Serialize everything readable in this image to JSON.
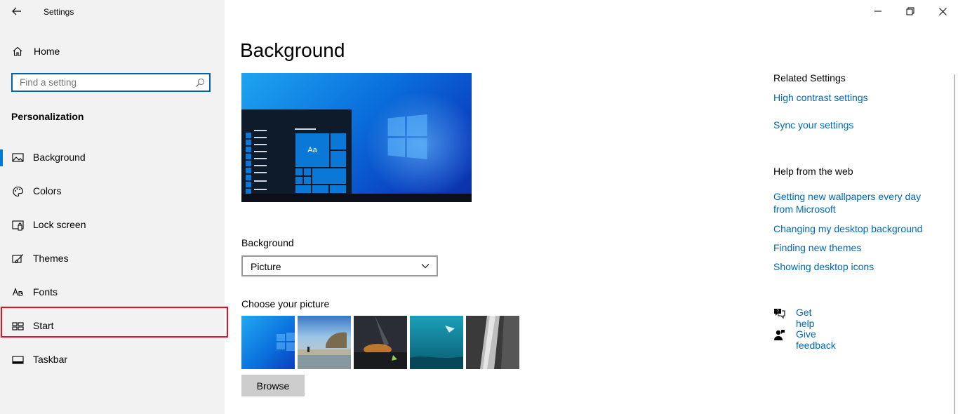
{
  "app": {
    "title": "Settings"
  },
  "sidebar": {
    "home_label": "Home",
    "search_placeholder": "Find a setting",
    "section_title": "Personalization",
    "items": [
      {
        "label": "Background",
        "icon": "image-icon",
        "selected": true
      },
      {
        "label": "Colors",
        "icon": "palette-icon"
      },
      {
        "label": "Lock screen",
        "icon": "lock-screen-icon"
      },
      {
        "label": "Themes",
        "icon": "brush-icon"
      },
      {
        "label": "Fonts",
        "icon": "font-icon"
      },
      {
        "label": "Start",
        "icon": "start-icon",
        "highlighted": true
      },
      {
        "label": "Taskbar",
        "icon": "taskbar-icon"
      }
    ]
  },
  "main": {
    "title": "Background",
    "preview": {
      "tile_text": "Aa"
    },
    "background_label": "Background",
    "background_value": "Picture",
    "choose_label": "Choose your picture",
    "browse_label": "Browse"
  },
  "related": {
    "heading": "Related Settings",
    "links": [
      "High contrast settings",
      "Sync your settings"
    ]
  },
  "help_web": {
    "heading": "Help from the web",
    "links": [
      "Getting new wallpapers every day from Microsoft",
      "Changing my desktop background",
      "Finding new themes",
      "Showing desktop icons"
    ]
  },
  "support": {
    "get_help": "Get help",
    "give_feedback": "Give feedback"
  },
  "colors": {
    "accent": "#0078d7",
    "link": "#0067b8",
    "highlight": "#e81123"
  }
}
